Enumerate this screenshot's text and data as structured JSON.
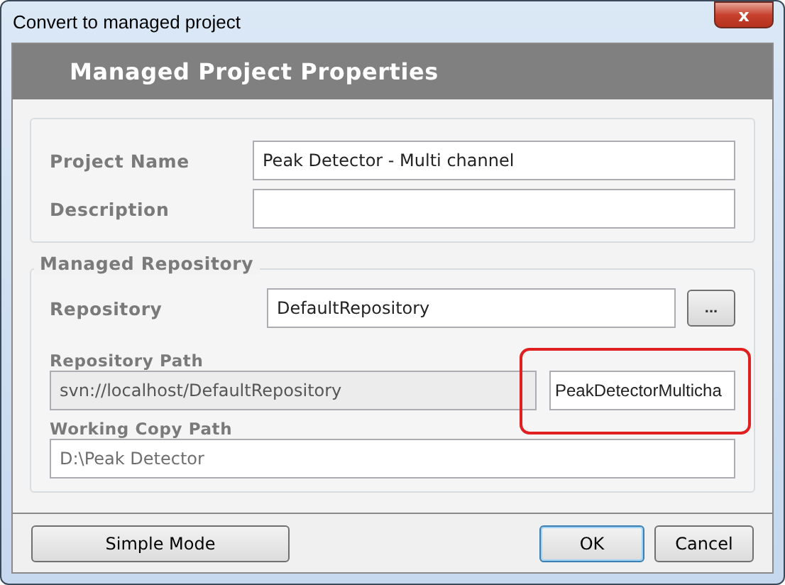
{
  "window": {
    "title": "Convert to managed project",
    "close_label": "x"
  },
  "header": {
    "title": "Managed Project Properties"
  },
  "project_group": {
    "fields": [
      {
        "label": "Project Name",
        "value": "Peak Detector - Multi channel",
        "disabled": false
      },
      {
        "label": "Description",
        "disabled": false
      }
    ]
  },
  "repository_group": {
    "legend": "Managed Repository",
    "repository": {
      "label": "Repository",
      "value": "DefaultRepository",
      "browse_label": "..."
    },
    "repository_path": {
      "label": "Repository Path",
      "value": "svn://localhost/DefaultRepository",
      "disabled": true,
      "suffix_value": "PeakDetectorMulticha",
      "highlighted": true
    },
    "working_copy_path": {
      "label": "Working Copy Path",
      "value": "D:\\Peak Detector",
      "disabled": true
    }
  },
  "buttons": [
    {
      "label": "Simple Mode",
      "default": false
    },
    {
      "label": "OK",
      "default": true
    },
    {
      "label": "Cancel",
      "default": false
    }
  ]
}
